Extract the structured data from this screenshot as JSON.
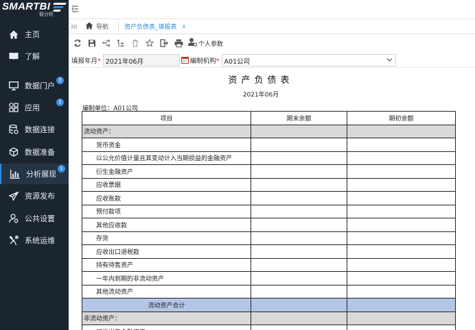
{
  "app": {
    "brand": "SMARTBI",
    "brand_sub": "智分析"
  },
  "sidebar": {
    "items": [
      {
        "label": "主页",
        "icon": "home-icon",
        "badge": ""
      },
      {
        "label": "了解",
        "icon": "book-icon",
        "badge": ""
      },
      {
        "label": "数据门户",
        "icon": "monitor-icon",
        "badge": "3"
      },
      {
        "label": "应用",
        "icon": "apps-icon",
        "badge": "2"
      },
      {
        "label": "数据连接",
        "icon": "database-icon",
        "badge": ""
      },
      {
        "label": "数据准备",
        "icon": "cube-icon",
        "badge": ""
      },
      {
        "label": "分析展现",
        "icon": "bar-chart-icon",
        "badge": "1"
      },
      {
        "label": "资源发布",
        "icon": "send-icon",
        "badge": ""
      },
      {
        "label": "公共设置",
        "icon": "settings-user-icon",
        "badge": ""
      },
      {
        "label": "系统运维",
        "icon": "tools-icon",
        "badge": ""
      }
    ],
    "active_index": 6,
    "accent": "#2c8ce0"
  },
  "tabs": [
    {
      "label": "导航",
      "icon": "home-icon"
    },
    {
      "label": "资产负债表_填报表",
      "close": "x"
    }
  ],
  "toolbar": {
    "buttons": [
      "refresh-icon",
      "save-icon",
      "flow-icon",
      "tree-icon",
      "delete-icon",
      "star-icon",
      "export-icon",
      "print-icon"
    ],
    "personal_params": "个人参数"
  },
  "params": {
    "period_label": "填报年月",
    "period_value": "2021年06月",
    "org_label": "编制机构",
    "org_value": "A01公司",
    "required_mark": "*"
  },
  "report": {
    "title": "资产负债表",
    "date": "2021年06月",
    "unit": "编制单位：A01公司",
    "headers": [
      "项目",
      "期末余额",
      "期初余额"
    ],
    "rows": [
      {
        "label": "流动资产：",
        "type": "sect"
      },
      {
        "label": "货币资金",
        "type": "item"
      },
      {
        "label": "以公允价值计量且其变动计入当期损益的金融资产",
        "type": "item"
      },
      {
        "label": "衍生金融资产",
        "type": "item"
      },
      {
        "label": "应收票据",
        "type": "item"
      },
      {
        "label": "应收账款",
        "type": "item"
      },
      {
        "label": "预付款项",
        "type": "item"
      },
      {
        "label": "其他应收款",
        "type": "item"
      },
      {
        "label": "存货",
        "type": "item"
      },
      {
        "label": "应收出口退税款",
        "type": "item"
      },
      {
        "label": "持有待售资产",
        "type": "item"
      },
      {
        "label": "一年内到期的非流动资产",
        "type": "item"
      },
      {
        "label": "其他流动资产",
        "type": "item"
      },
      {
        "label": "流动资产合计",
        "type": "total"
      },
      {
        "label": "非流动资产：",
        "type": "sect"
      },
      {
        "label": "可供出售金融资产",
        "type": "item"
      }
    ]
  }
}
